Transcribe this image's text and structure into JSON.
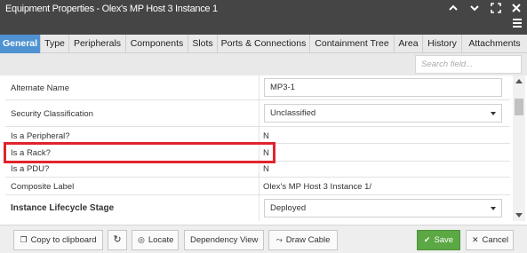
{
  "window": {
    "title": "Equipment Properties - Olex's MP Host 3 Instance 1"
  },
  "tabs": [
    {
      "label": "General",
      "active": true
    },
    {
      "label": "Type"
    },
    {
      "label": "Peripherals"
    },
    {
      "label": "Components"
    },
    {
      "label": "Slots"
    },
    {
      "label": "Ports & Connections"
    },
    {
      "label": "Containment Tree"
    },
    {
      "label": "Area"
    },
    {
      "label": "History"
    },
    {
      "label": "Attachments"
    }
  ],
  "search": {
    "placeholder": "Search field..."
  },
  "fields": {
    "alternate_name": {
      "label": "Alternate Name",
      "value": "MP3-1"
    },
    "security_classification": {
      "label": "Security Classification",
      "value": "Unclassified"
    },
    "is_peripheral": {
      "label": "Is a Peripheral?",
      "value": "N"
    },
    "is_rack": {
      "label": "Is a Rack?",
      "value": "N"
    },
    "is_pdu": {
      "label": "Is a PDU?",
      "value": "N"
    },
    "composite_label": {
      "label": "Composite Label",
      "value": "Olex's MP Host 3 Instance 1/"
    },
    "instance_lifecycle_stage": {
      "label": "Instance Lifecycle Stage",
      "value": "Deployed"
    }
  },
  "footer": {
    "copy_label": "Copy to clipboard",
    "locate_label": "Locate",
    "dependency_label": "Dependency View",
    "draw_cable_label": "Draw Cable",
    "save_label": "Save",
    "cancel_label": "Cancel"
  },
  "colors": {
    "titlebar": "#454545",
    "active_tab": "#4f92d1",
    "save_button": "#5ba844",
    "highlight": "#e0242b"
  }
}
